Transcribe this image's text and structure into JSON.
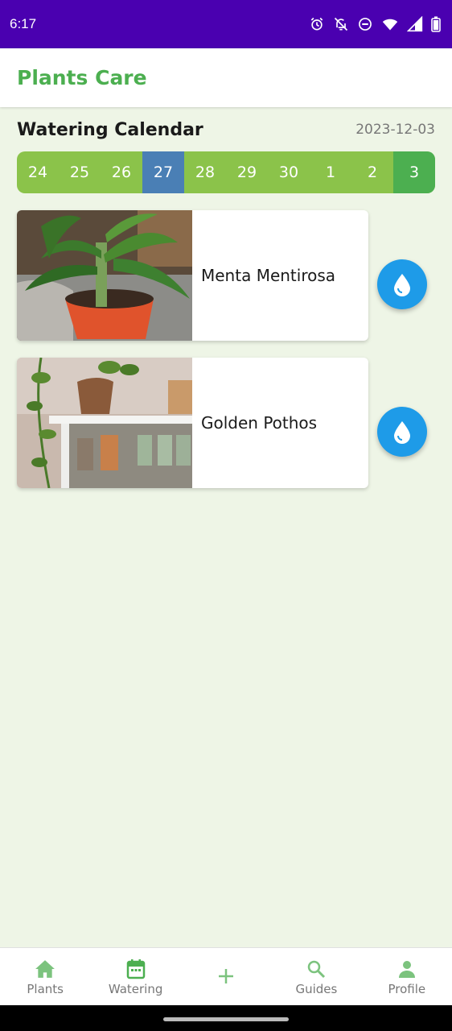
{
  "status_bar": {
    "time": "6:17"
  },
  "app_bar": {
    "title": "Plants Care"
  },
  "watering": {
    "title": "Watering Calendar",
    "date": "2023-12-03",
    "days": [
      {
        "label": "24",
        "state": "normal"
      },
      {
        "label": "25",
        "state": "normal"
      },
      {
        "label": "26",
        "state": "normal"
      },
      {
        "label": "27",
        "state": "selected"
      },
      {
        "label": "28",
        "state": "normal"
      },
      {
        "label": "29",
        "state": "normal"
      },
      {
        "label": "30",
        "state": "normal"
      },
      {
        "label": "1",
        "state": "normal"
      },
      {
        "label": "2",
        "state": "normal"
      },
      {
        "label": "3",
        "state": "today"
      }
    ],
    "plants": [
      {
        "name": "Menta Mentirosa"
      },
      {
        "name": "Golden Pothos"
      }
    ]
  },
  "bottom_nav": {
    "items": [
      {
        "label": "Plants",
        "icon": "home-icon"
      },
      {
        "label": "Watering",
        "icon": "calendar-icon"
      },
      {
        "label": "",
        "icon": "add-icon"
      },
      {
        "label": "Guides",
        "icon": "search-icon"
      },
      {
        "label": "Profile",
        "icon": "person-icon"
      }
    ]
  },
  "colors": {
    "status_bar": "#4a00b0",
    "accent_green": "#4caf50",
    "calendar_green": "#8bc34a",
    "selected_day": "#4a7fb5",
    "water_button": "#1e9be8",
    "background": "#eef5e6"
  }
}
